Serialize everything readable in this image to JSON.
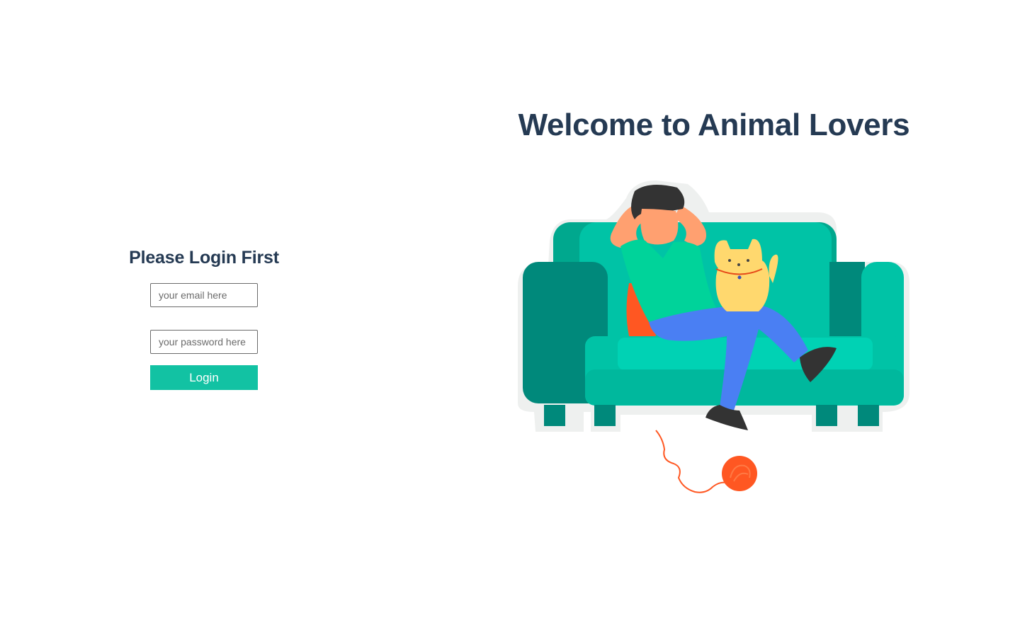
{
  "login": {
    "title": "Please Login First",
    "email": {
      "placeholder": "your email here",
      "value": ""
    },
    "password": {
      "placeholder": "your password here",
      "value": ""
    },
    "submit_label": "Login"
  },
  "hero": {
    "title": "Welcome to Animal Lovers",
    "illustration": "person-with-cat-on-couch-illustration"
  },
  "colors": {
    "heading": "#253a53",
    "accent": "#12c2a3",
    "couch": "#00bfa5",
    "couch_dark": "#00897b",
    "yarn": "#ff5722",
    "cat": "#ffd86e",
    "shirt": "#00d39a",
    "pants": "#4a7ff3"
  }
}
